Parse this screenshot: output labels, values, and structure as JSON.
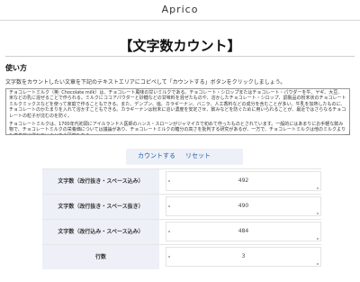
{
  "header": {
    "site_title": "Aprico"
  },
  "page": {
    "title": "【文字数カウント】",
    "section_heading": "使い方",
    "instruction": "文字数をカウントしたい文章を下記のテキストエリアにコピペして「カウントする」ボタンをクリックしましょう。"
  },
  "textarea": {
    "paragraphs": [
      "チョコレートミルク（英: Chocolate milk）は、チョコレート風味の甘いミルクである。チョコレート・シロップまたはチョコレート・パウダーを牛、ヤギ、大豆、米などの乳に混ぜることで作られる。ミルクにココアパウダーと砂糖などの甘味料を混ぜたものや、溶かしたチョコレート・シロップ、調製品の粉末状のチョコレートミルクミックスなどを使って家庭で作ることもできる。また、デンプン、塩、カラギーナン、バニラ、人工香料などの成分を含むことが多い。牛乳を加熱したものに、チョコレートのかたまりを入れて溶かすこともできる。カラギーナンは粉末に溶い濃度を安定させ、飲みなどを防ぐために用いられることが、最近ではさらなるチョコレートの粒子が沈むのを防ぐ。",
      "チョコレートミルクは、1700年代初頭にアイルランド人医師のハンス・スローンがジャマイカで初めて作ったものとされています。一般的にはあまりにお手軽な飲み物で、チョコレートミルクの栄養価については議論があり、チョコレートミルクの糖分の高さを批判する研究があるが、一方で、チョコレートミルクは他のミルクよりも栄養的に優れているとする研究もある。"
    ]
  },
  "buttons": {
    "count": "カウントする",
    "reset": "リセット"
  },
  "stats": [
    {
      "label": "文字数（改行抜き・スペース込み）",
      "value": "492"
    },
    {
      "label": "文字数（改行抜き・スペース抜き）",
      "value": "490"
    },
    {
      "label": "文字数（改行込み・スペース込み）",
      "value": "484"
    },
    {
      "label": "行数",
      "value": "3"
    }
  ]
}
